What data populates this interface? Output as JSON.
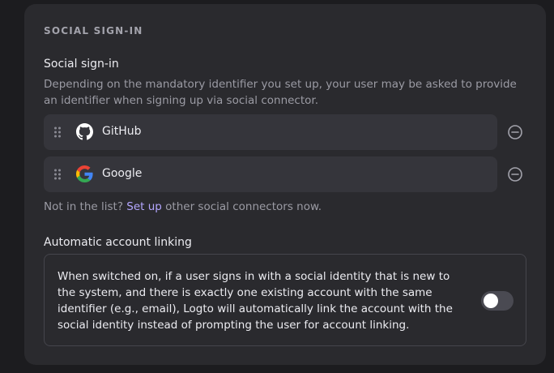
{
  "section": {
    "title": "SOCIAL SIGN-IN"
  },
  "social_signin": {
    "label": "Social sign-in",
    "description": "Depending on the mandatory identifier you set up, your user may be asked to provide an identifier when signing up via social connector.",
    "connectors": [
      {
        "name": "GitHub",
        "icon": "github-icon"
      },
      {
        "name": "Google",
        "icon": "google-icon"
      }
    ],
    "hint_prefix": "Not in the list?",
    "hint_link": "Set up",
    "hint_suffix": "other social connectors now."
  },
  "account_linking": {
    "label": "Automatic account linking",
    "description": "When switched on, if a user signs in with a social identity that is new to the system, and there is exactly one existing account with the same identifier (e.g., email), Logto will automatically link the account with the social identity instead of prompting the user for account linking.",
    "enabled": false
  },
  "colors": {
    "card_bg": "#2a2a2e",
    "row_bg": "#35353b",
    "link": "#b4a7ff"
  }
}
